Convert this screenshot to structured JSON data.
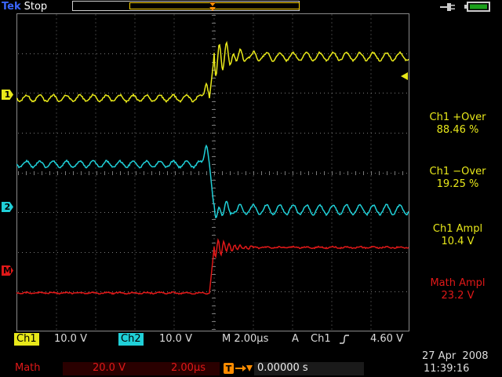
{
  "header": {
    "brand": "Tek",
    "run_state": "Stop"
  },
  "trigger_marker": "T",
  "markers": {
    "ch1": "1",
    "ch2": "2",
    "math": "M"
  },
  "measurements": [
    {
      "name": "Ch1 +Over",
      "value": "88.46 %"
    },
    {
      "name": "Ch1 −Over",
      "value": "19.25 %"
    },
    {
      "name": "Ch1 Ampl",
      "value": "10.4 V"
    },
    {
      "name": "Math Ampl",
      "value": "23.2 V"
    }
  ],
  "status": {
    "ch1_label": "Ch1",
    "ch1_scale": "10.0 V",
    "ch2_label": "Ch2",
    "ch2_scale": "10.0 V",
    "time_scale": "M 2.00µs",
    "trigger_mode": "A",
    "trigger_source": "Ch1",
    "trigger_level": "4.60 V",
    "math_label": "Math",
    "math_scale": "20.0 V",
    "math_time": "2.00µs",
    "trigger_offset": "0.00000 s",
    "date": "27 Apr  2008",
    "time": "11:39:16"
  },
  "colors": {
    "ch1": "#e8e81a",
    "ch2": "#20d0d8",
    "math": "#e01818",
    "brand": "#3a66ff",
    "trigger": "#ff8c00"
  }
}
